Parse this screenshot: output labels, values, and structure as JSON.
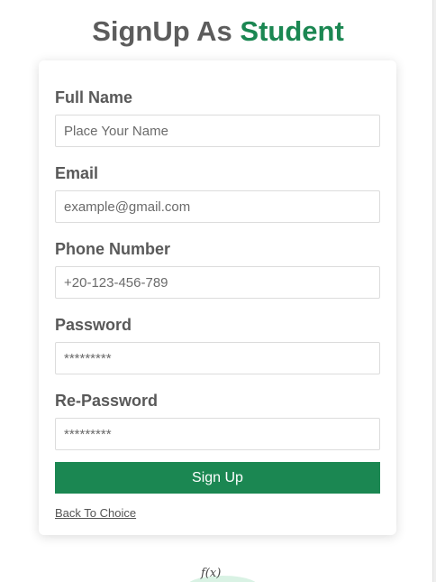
{
  "header": {
    "title_prefix": "SignUp As",
    "title_accent": "Student"
  },
  "form": {
    "fields": [
      {
        "label": "Full Name",
        "placeholder": "Place Your Name",
        "type": "text"
      },
      {
        "label": "Email",
        "placeholder": "example@gmail.com",
        "type": "email"
      },
      {
        "label": "Phone Number",
        "placeholder": "+20-123-456-789",
        "type": "tel"
      },
      {
        "label": "Password",
        "placeholder": "*********",
        "type": "password"
      },
      {
        "label": "Re-Password",
        "placeholder": "*********",
        "type": "password"
      }
    ],
    "submit_label": "Sign Up",
    "back_link": "Back To Choice"
  },
  "footer": {
    "formula_text": "f(x)"
  },
  "colors": {
    "accent": "#1b8752",
    "title": "#5c5c5c",
    "label": "#595959"
  }
}
